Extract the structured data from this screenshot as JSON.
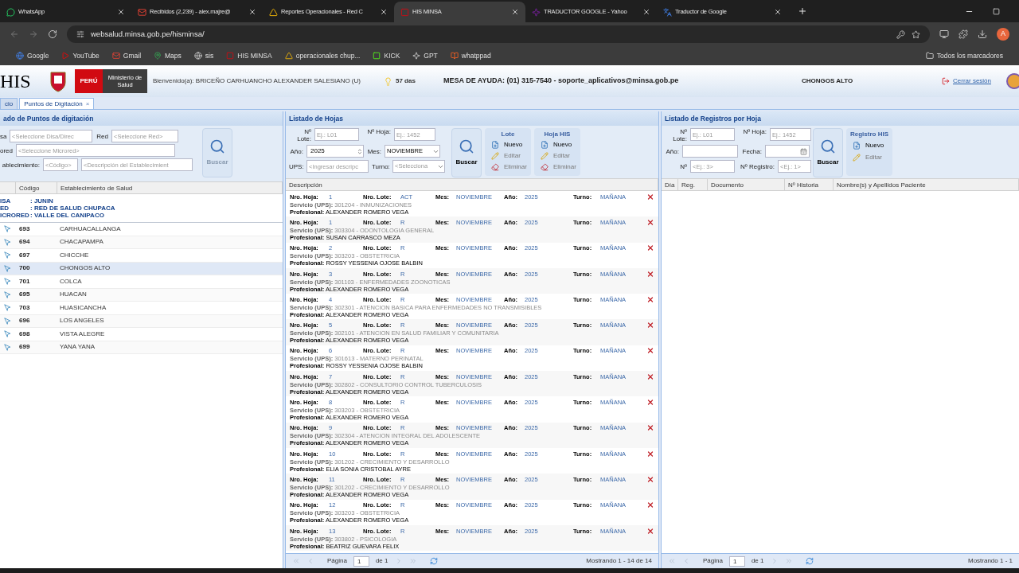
{
  "browser": {
    "tabs": [
      {
        "title": "WhatsApp",
        "selected": false
      },
      {
        "title": "Recibidos (2,239) - alex.majre@",
        "selected": false
      },
      {
        "title": "Reportes Operacionales - Red C",
        "selected": false
      },
      {
        "title": "HIS MINSA",
        "selected": true
      },
      {
        "title": "TRADUCTOR GOOGLE - Yahoo",
        "selected": false
      },
      {
        "title": "Traductor de Google",
        "selected": false
      }
    ],
    "url": "websalud.minsa.gob.pe/hisminsa/",
    "avatar": "A",
    "bookmarks": [
      "Google",
      "YouTube",
      "Gmail",
      "Maps",
      "sis",
      "HIS MINSA",
      "operacionales chup...",
      "KICK",
      "GPT",
      "whatppad"
    ],
    "all_bookmarks": "Todos los marcadores"
  },
  "header": {
    "logo": "HIS",
    "country": "PERÚ",
    "ministry": "Ministerio de Salud",
    "welcome": "Bienvenido(a): BRICEÑO CARHUANCHO ALEXANDER SALESIANO (U)",
    "days": "57 das",
    "help": "MESA DE AYUDA: (01) 315-7540 - soporte_aplicativos@minsa.gob.pe",
    "location": "CHONGOS ALTO",
    "logout": "Cerrar sesión"
  },
  "app_tabs": [
    {
      "label": "cio",
      "selected": false
    },
    {
      "label": "Puntos de Digitación",
      "selected": true,
      "close": "×"
    }
  ],
  "left": {
    "title": "ado de Puntos de digitación",
    "filters": [
      {
        "label": "sa",
        "placeholder": "<Seleccione Disa/Direc"
      },
      {
        "label": "Red",
        "placeholder": "<Seleccione Red>"
      },
      {
        "label": "ored",
        "placeholder": "<Seleccione Microred>"
      },
      {
        "label": "ablecimiento:",
        "placeholder": "<Código>"
      },
      {
        "placeholder": "<Descripción del Establecimient"
      }
    ],
    "search": {
      "label": "Buscar",
      "disabled": true
    },
    "columns": [
      "Código",
      "Establecimiento de Salud"
    ],
    "group": [
      [
        "ISA",
        ": JUNIN"
      ],
      [
        "ED",
        ": RED DE SALUD CHUPACA"
      ],
      [
        "ICRORED",
        ": VALLE DEL CANIPACO"
      ]
    ],
    "rows": [
      {
        "code": "693",
        "name": "CARHUACALLANGA",
        "selected": false
      },
      {
        "code": "694",
        "name": "CHACAPAMPA",
        "selected": false
      },
      {
        "code": "697",
        "name": "CHICCHE",
        "selected": false
      },
      {
        "code": "700",
        "name": "CHONGOS ALTO",
        "selected": true
      },
      {
        "code": "701",
        "name": "COLCA",
        "selected": false
      },
      {
        "code": "695",
        "name": "HUACAN",
        "selected": false
      },
      {
        "code": "703",
        "name": "HUASICANCHA",
        "selected": false
      },
      {
        "code": "696",
        "name": "LOS ANGELES",
        "selected": false
      },
      {
        "code": "698",
        "name": "VISTA ALEGRE",
        "selected": false
      },
      {
        "code": "699",
        "name": "YANA YANA",
        "selected": false
      }
    ]
  },
  "middle": {
    "title": "Listado de Hojas",
    "fields": {
      "lote": {
        "label": "Nº Lote:",
        "placeholder": "Ej.: L01"
      },
      "hoja": {
        "label": "Nº Hoja:",
        "placeholder": "Ej.: 1452"
      },
      "anio": {
        "label": "Año:",
        "value": "2025"
      },
      "mes": {
        "label": "Mes:",
        "value": "NOVIEMBRE"
      },
      "ups": {
        "label": "UPS:",
        "placeholder": "<Ingresar descripc"
      },
      "turno": {
        "label": "Turno:",
        "placeholder": "<Selecciona"
      }
    },
    "search": {
      "label": "Buscar",
      "disabled": false
    },
    "groups": [
      {
        "title": "Lote",
        "actions": [
          {
            "kind": "new",
            "label": "Nuevo",
            "disabled": false
          },
          {
            "kind": "edit",
            "label": "Editar",
            "disabled": true
          },
          {
            "kind": "delete",
            "label": "Eliminar",
            "disabled": true
          }
        ]
      },
      {
        "title": "Hoja HIS",
        "actions": [
          {
            "kind": "new",
            "label": "Nuevo",
            "disabled": false
          },
          {
            "kind": "edit",
            "label": "Editar",
            "disabled": true
          },
          {
            "kind": "delete",
            "label": "Eliminar",
            "disabled": true
          }
        ]
      }
    ],
    "column": "Descripción",
    "rows": [
      {
        "line": [
          [
            "Nro. Hoja:",
            "1"
          ],
          [
            "Nro. Lote:",
            "ACT"
          ],
          [
            "Mes:",
            "NOVIEMBRE"
          ],
          [
            "Año:",
            "2025"
          ],
          [
            "Turno:",
            "MAÑANA"
          ]
        ],
        "servicio": [
          "Servicio (UPS):",
          "301204 - INMUNIZACIONES"
        ],
        "profesional": [
          "Profesional:",
          "ALEXANDER ROMERO VEGA"
        ]
      },
      {
        "line": [
          [
            "Nro. Hoja:",
            "1"
          ],
          [
            "Nro. Lote:",
            "R"
          ],
          [
            "Mes:",
            "NOVIEMBRE"
          ],
          [
            "Año:",
            "2025"
          ],
          [
            "Turno:",
            "MAÑANA"
          ]
        ],
        "servicio": [
          "Servicio (UPS):",
          "303304 - ODONTOLOGIA GENERAL"
        ],
        "profesional": [
          "Profesional:",
          "SUSAN CARRASCO MEZA"
        ]
      },
      {
        "line": [
          [
            "Nro. Hoja:",
            "2"
          ],
          [
            "Nro. Lote:",
            "R"
          ],
          [
            "Mes:",
            "NOVIEMBRE"
          ],
          [
            "Año:",
            "2025"
          ],
          [
            "Turno:",
            "MAÑANA"
          ]
        ],
        "servicio": [
          "Servicio (UPS):",
          "303203 - OBSTETRICIA"
        ],
        "profesional": [
          "Profesional:",
          "ROSSY YESSENIA OJOSE BALBIN"
        ]
      },
      {
        "line": [
          [
            "Nro. Hoja:",
            "3"
          ],
          [
            "Nro. Lote:",
            "R"
          ],
          [
            "Mes:",
            "NOVIEMBRE"
          ],
          [
            "Año:",
            "2025"
          ],
          [
            "Turno:",
            "MAÑANA"
          ]
        ],
        "servicio": [
          "Servicio (UPS):",
          "301103 - ENFERMEDADES ZOONOTICAS"
        ],
        "profesional": [
          "Profesional:",
          "ALEXANDER ROMERO VEGA"
        ]
      },
      {
        "line": [
          [
            "Nro. Hoja:",
            "4"
          ],
          [
            "Nro. Lote:",
            "R"
          ],
          [
            "Mes:",
            "NOVIEMBRE"
          ],
          [
            "Año:",
            "2025"
          ],
          [
            "Turno:",
            "MAÑANA"
          ]
        ],
        "servicio": [
          "Servicio (UPS):",
          "302301 - ATENCION BASICA PARA ENFERMEDADES NO TRANSMISIBLES"
        ],
        "profesional": [
          "Profesional:",
          "ALEXANDER ROMERO VEGA"
        ]
      },
      {
        "line": [
          [
            "Nro. Hoja:",
            "5"
          ],
          [
            "Nro. Lote:",
            "R"
          ],
          [
            "Mes:",
            "NOVIEMBRE"
          ],
          [
            "Año:",
            "2025"
          ],
          [
            "Turno:",
            "MAÑANA"
          ]
        ],
        "servicio": [
          "Servicio (UPS):",
          "302101 - ATENCION EN SALUD FAMILIAR Y COMUNITARIA"
        ],
        "profesional": [
          "Profesional:",
          "ALEXANDER ROMERO VEGA"
        ]
      },
      {
        "line": [
          [
            "Nro. Hoja:",
            "6"
          ],
          [
            "Nro. Lote:",
            "R"
          ],
          [
            "Mes:",
            "NOVIEMBRE"
          ],
          [
            "Año:",
            "2025"
          ],
          [
            "Turno:",
            "MAÑANA"
          ]
        ],
        "servicio": [
          "Servicio (UPS):",
          "301613 - MATERNO PERINATAL"
        ],
        "profesional": [
          "Profesional:",
          "ROSSY YESSENIA OJOSE BALBIN"
        ]
      },
      {
        "line": [
          [
            "Nro. Hoja:",
            "7"
          ],
          [
            "Nro. Lote:",
            "R"
          ],
          [
            "Mes:",
            "NOVIEMBRE"
          ],
          [
            "Año:",
            "2025"
          ],
          [
            "Turno:",
            "MAÑANA"
          ]
        ],
        "servicio": [
          "Servicio (UPS):",
          "302802 - CONSULTORIO CONTROL TUBERCULOSIS"
        ],
        "profesional": [
          "Profesional:",
          "ALEXANDER ROMERO VEGA"
        ]
      },
      {
        "line": [
          [
            "Nro. Hoja:",
            "8"
          ],
          [
            "Nro. Lote:",
            "R"
          ],
          [
            "Mes:",
            "NOVIEMBRE"
          ],
          [
            "Año:",
            "2025"
          ],
          [
            "Turno:",
            "MAÑANA"
          ]
        ],
        "servicio": [
          "Servicio (UPS):",
          "303203 - OBSTETRICIA"
        ],
        "profesional": [
          "Profesional:",
          "ALEXANDER ROMERO VEGA"
        ]
      },
      {
        "line": [
          [
            "Nro. Hoja:",
            "9"
          ],
          [
            "Nro. Lote:",
            "R"
          ],
          [
            "Mes:",
            "NOVIEMBRE"
          ],
          [
            "Año:",
            "2025"
          ],
          [
            "Turno:",
            "MAÑANA"
          ]
        ],
        "servicio": [
          "Servicio (UPS):",
          "302304 - ATENCION INTEGRAL DEL ADOLESCENTE"
        ],
        "profesional": [
          "Profesional:",
          "ALEXANDER ROMERO VEGA"
        ]
      },
      {
        "line": [
          [
            "Nro. Hoja:",
            "10"
          ],
          [
            "Nro. Lote:",
            "R"
          ],
          [
            "Mes:",
            "NOVIEMBRE"
          ],
          [
            "Año:",
            "2025"
          ],
          [
            "Turno:",
            "MAÑANA"
          ]
        ],
        "servicio": [
          "Servicio (UPS):",
          "301202 - CRECIMIENTO Y DESARROLLO"
        ],
        "profesional": [
          "Profesional:",
          "ELIA SONIA CRISTOBAL AYRE"
        ]
      },
      {
        "line": [
          [
            "Nro. Hoja:",
            "11"
          ],
          [
            "Nro. Lote:",
            "R"
          ],
          [
            "Mes:",
            "NOVIEMBRE"
          ],
          [
            "Año:",
            "2025"
          ],
          [
            "Turno:",
            "MAÑANA"
          ]
        ],
        "servicio": [
          "Servicio (UPS):",
          "301202 - CRECIMIENTO Y DESARROLLO"
        ],
        "profesional": [
          "Profesional:",
          "ALEXANDER ROMERO VEGA"
        ]
      },
      {
        "line": [
          [
            "Nro. Hoja:",
            "12"
          ],
          [
            "Nro. Lote:",
            "R"
          ],
          [
            "Mes:",
            "NOVIEMBRE"
          ],
          [
            "Año:",
            "2025"
          ],
          [
            "Turno:",
            "MAÑANA"
          ]
        ],
        "servicio": [
          "Servicio (UPS):",
          "303203 - OBSTETRICIA"
        ],
        "profesional": [
          "Profesional:",
          "ALEXANDER ROMERO VEGA"
        ]
      },
      {
        "line": [
          [
            "Nro. Hoja:",
            "13"
          ],
          [
            "Nro. Lote:",
            "R"
          ],
          [
            "Mes:",
            "NOVIEMBRE"
          ],
          [
            "Año:",
            "2025"
          ],
          [
            "Turno:",
            "MAÑANA"
          ]
        ],
        "servicio": [
          "Servicio (UPS):",
          "303802 - PSICOLOGIA"
        ],
        "profesional": [
          "Profesional:",
          "BEATRIZ GUEVARA FELIX"
        ]
      }
    ],
    "pager": {
      "page_label": "Página",
      "page": "1",
      "of": "de 1",
      "summary": "Mostrando 1 - 14 de 14"
    }
  },
  "right": {
    "title": "Listado de Registros por Hoja",
    "fields": {
      "lote": {
        "label": "Nº Lote:",
        "placeholder": "Ej.: L01"
      },
      "hoja": {
        "label": "Nº Hoja:",
        "placeholder": "Ej.: 1452"
      },
      "anio": {
        "label": "Año:"
      },
      "fecha": {
        "label": "Fecha:"
      },
      "pag": {
        "label": "Nº",
        "placeholder": "<Ej.: 3>"
      },
      "registro": {
        "label": "Nº Registro:",
        "placeholder": "<Ej.: 1>"
      }
    },
    "search": {
      "label": "Buscar",
      "disabled": false
    },
    "groups": [
      {
        "title": "Registro HIS",
        "actions": [
          {
            "kind": "new",
            "label": "Nuevo",
            "disabled": false
          },
          {
            "kind": "edit",
            "label": "Editar",
            "disabled": true
          }
        ]
      }
    ],
    "columns": [
      "Día",
      "Reg.",
      "Documento",
      "Nº Historia",
      "Nombre(s) y Apellidos Paciente"
    ],
    "pager": {
      "page_label": "Página",
      "page": "1",
      "of": "de 1",
      "summary": "Mostrando 1 - 1"
    }
  }
}
